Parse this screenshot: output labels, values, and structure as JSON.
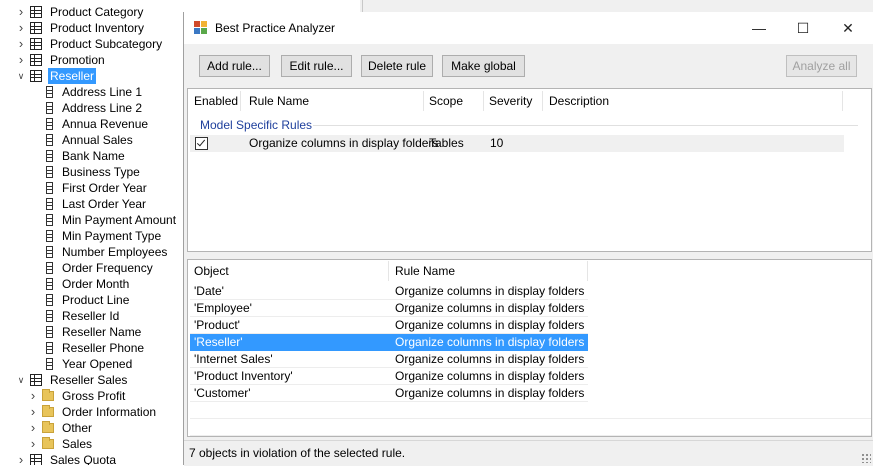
{
  "tree": {
    "items": [
      {
        "label": "Product Category",
        "kind": "table",
        "expanded": false,
        "level": 0
      },
      {
        "label": "Product Inventory",
        "kind": "table",
        "expanded": false,
        "level": 0
      },
      {
        "label": "Product Subcategory",
        "kind": "table",
        "expanded": false,
        "level": 0
      },
      {
        "label": "Promotion",
        "kind": "table",
        "expanded": false,
        "level": 0
      },
      {
        "label": "Reseller",
        "kind": "table",
        "expanded": true,
        "level": 0,
        "selected": true
      },
      {
        "label": "Address Line 1",
        "kind": "column",
        "level": 1
      },
      {
        "label": "Address Line 2",
        "kind": "column",
        "level": 1
      },
      {
        "label": "Annua Revenue",
        "kind": "column",
        "level": 1
      },
      {
        "label": "Annual Sales",
        "kind": "column",
        "level": 1
      },
      {
        "label": "Bank Name",
        "kind": "column",
        "level": 1
      },
      {
        "label": "Business Type",
        "kind": "column",
        "level": 1
      },
      {
        "label": "First Order Year",
        "kind": "column",
        "level": 1
      },
      {
        "label": "Last Order Year",
        "kind": "column",
        "level": 1
      },
      {
        "label": "Min Payment Amount",
        "kind": "column",
        "level": 1
      },
      {
        "label": "Min Payment Type",
        "kind": "column",
        "level": 1
      },
      {
        "label": "Number Employees",
        "kind": "column",
        "level": 1
      },
      {
        "label": "Order Frequency",
        "kind": "column",
        "level": 1
      },
      {
        "label": "Order Month",
        "kind": "column",
        "level": 1
      },
      {
        "label": "Product Line",
        "kind": "column",
        "level": 1
      },
      {
        "label": "Reseller Id",
        "kind": "column",
        "level": 1
      },
      {
        "label": "Reseller Name",
        "kind": "column",
        "level": 1
      },
      {
        "label": "Reseller Phone",
        "kind": "column",
        "level": 1
      },
      {
        "label": "Year Opened",
        "kind": "column",
        "level": 1
      },
      {
        "label": "Reseller Sales",
        "kind": "table",
        "expanded": true,
        "level": 0
      },
      {
        "label": "Gross Profit",
        "kind": "folder",
        "expanded": false,
        "level": 1
      },
      {
        "label": "Order Information",
        "kind": "folder",
        "expanded": false,
        "level": 1
      },
      {
        "label": "Other",
        "kind": "folder",
        "expanded": false,
        "level": 1
      },
      {
        "label": "Sales",
        "kind": "folder",
        "expanded": false,
        "level": 1
      },
      {
        "label": "Sales Quota",
        "kind": "table",
        "expanded": false,
        "level": 0
      }
    ]
  },
  "dialog": {
    "title": "Best Practice Analyzer",
    "window_buttons": {
      "minimize": "—",
      "maximize": "☐",
      "close": "✕"
    },
    "toolbar": {
      "add_rule": "Add rule...",
      "edit_rule": "Edit rule...",
      "delete_rule": "Delete rule",
      "make_global": "Make global",
      "analyze_all": "Analyze all"
    },
    "rules": {
      "headers": {
        "enabled": "Enabled",
        "rule_name": "Rule Name",
        "scope": "Scope",
        "severity": "Severity",
        "description": "Description"
      },
      "group": "Model Specific Rules",
      "rows": [
        {
          "enabled": true,
          "rule_name": "Organize columns in display folders",
          "scope": "Tables",
          "severity": "10",
          "description": ""
        }
      ]
    },
    "objects": {
      "headers": {
        "object": "Object",
        "rule_name": "Rule Name"
      },
      "rows": [
        {
          "object": "'Date'",
          "rule_name": "Organize columns in display folders"
        },
        {
          "object": "'Employee'",
          "rule_name": "Organize columns in display folders"
        },
        {
          "object": "'Product'",
          "rule_name": "Organize columns in display folders"
        },
        {
          "object": "'Reseller'",
          "rule_name": "Organize columns in display folders",
          "selected": true
        },
        {
          "object": "'Internet Sales'",
          "rule_name": "Organize columns in display folders"
        },
        {
          "object": "'Product Inventory'",
          "rule_name": "Organize columns in display folders"
        },
        {
          "object": "'Customer'",
          "rule_name": "Organize columns in display folders"
        }
      ]
    },
    "status": "7 objects in violation of the selected rule."
  },
  "colors": {
    "selection": "#3399ff",
    "group_label": "#1e3f9c",
    "dialog_bg": "#f0f0f0",
    "button_bg": "#e1e1e1"
  }
}
